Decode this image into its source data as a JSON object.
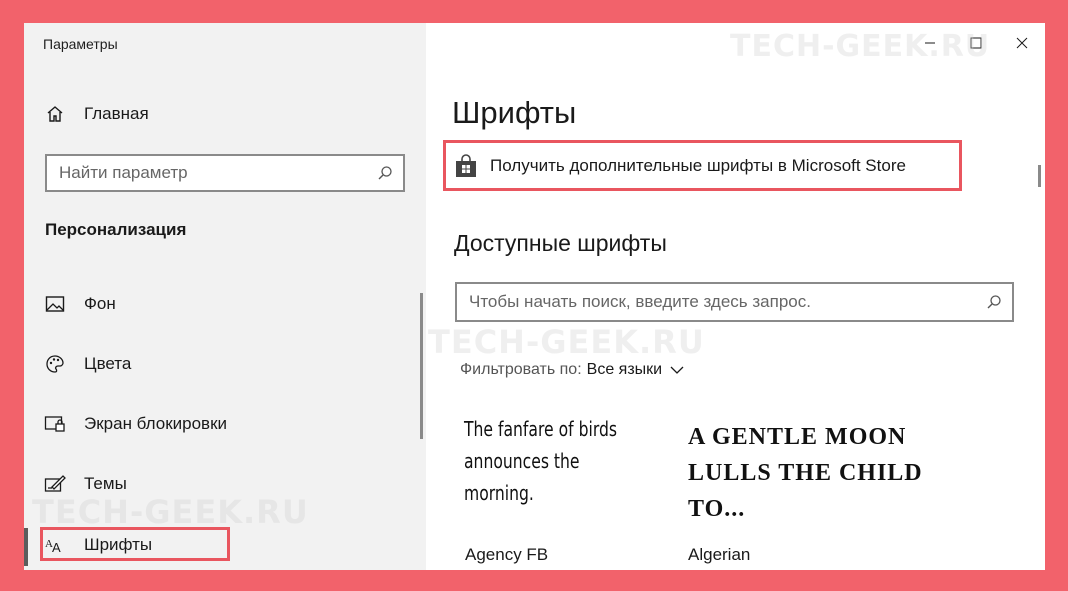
{
  "window": {
    "title": "Параметры"
  },
  "sidebar": {
    "home_label": "Главная",
    "search_placeholder": "Найти параметр",
    "section": "Персонализация",
    "items": [
      {
        "label": "Фон",
        "icon": "image-icon"
      },
      {
        "label": "Цвета",
        "icon": "palette-icon"
      },
      {
        "label": "Экран блокировки",
        "icon": "lock-screen-icon"
      },
      {
        "label": "Темы",
        "icon": "themes-icon"
      },
      {
        "label": "Шрифты",
        "icon": "fonts-icon",
        "selected": true
      }
    ]
  },
  "main": {
    "title": "Шрифты",
    "store_link": "Получить дополнительные шрифты в Microsoft Store",
    "available_heading": "Доступные шрифты",
    "font_search_placeholder": "Чтобы начать поиск, введите здесь запрос.",
    "filter_label": "Фильтровать по:",
    "filter_value": "Все языки",
    "fonts": [
      {
        "preview": "The fanfare of birds announces the morning.",
        "name": "Agency FB"
      },
      {
        "preview": "A GENTLE MOON LULLS THE CHILD TO...",
        "name": "Algerian"
      }
    ]
  },
  "watermark": "TECH-GEEK.RU",
  "colors": {
    "highlight": "#e9565f",
    "frame": "#f2626b"
  }
}
